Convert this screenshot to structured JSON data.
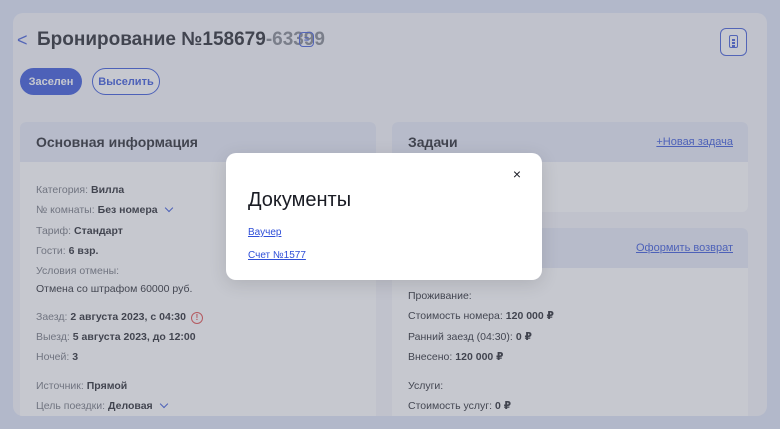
{
  "header": {
    "back_glyph": "<",
    "title_main": "Бронирование №158679",
    "title_suffix": "-63399",
    "list_icon": "list-icon",
    "doc_icon": "document-icon"
  },
  "actions": {
    "checkin_label": "Заселен",
    "checkout_label": "Выселить"
  },
  "main_info": {
    "title": "Основная информация",
    "rows": [
      {
        "label": "Категория:",
        "value": "Вилла"
      },
      {
        "label": "№ комнаты:",
        "value": "Без номера"
      },
      {
        "label": "Тариф:",
        "value": "Стандарт"
      },
      {
        "label": "Гости:",
        "value": "6 взр."
      },
      {
        "label": "Условия отмены:",
        "value": ""
      },
      {
        "label": "",
        "value": "Отмена со штрафом 60000 руб."
      },
      {
        "label": "Заезд:",
        "value": "2 августа 2023, с 04:30"
      },
      {
        "label": "Выезд:",
        "value": "5 августа 2023, до 12:00"
      },
      {
        "label": "Ночей:",
        "value": "3"
      },
      {
        "label": "Источник:",
        "value": "Прямой"
      },
      {
        "label": "Цель поездки:",
        "value": "Деловая"
      }
    ]
  },
  "tasks": {
    "title": "Задачи",
    "new_task_link": "+Новая задача"
  },
  "payment": {
    "refund_link": "Оформить возврат",
    "stay_heading": "Проживание:",
    "rows": [
      {
        "label": "Стоимость номера:",
        "value": "120 000 ₽"
      },
      {
        "label": "Ранний заезд (04:30):",
        "value": "0 ₽"
      },
      {
        "label": "Внесено:",
        "value": "120 000 ₽"
      }
    ],
    "services_heading": "Услуги:",
    "services_rows": [
      {
        "label": "Стоимость услуг:",
        "value": "0 ₽"
      }
    ]
  },
  "modal": {
    "title": "Документы",
    "close_glyph": "×",
    "links": [
      "Ваучер",
      "Счет №1577"
    ]
  },
  "colors": {
    "accent": "#2f4fd8",
    "warning": "#e04343"
  }
}
